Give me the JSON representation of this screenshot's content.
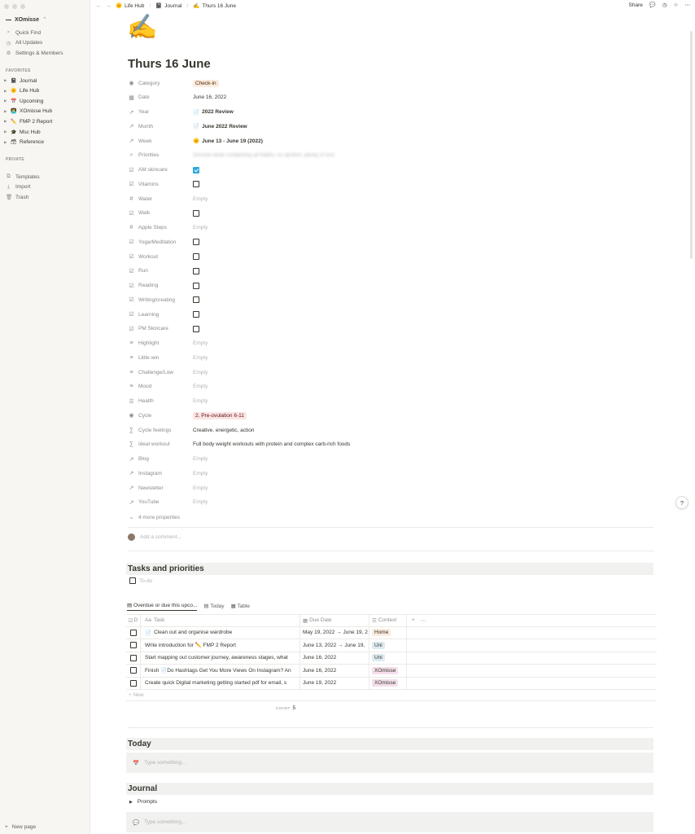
{
  "sidebar": {
    "workspace": "XOmisse",
    "nav": [
      {
        "icon": "⌕",
        "label": "Quick Find",
        "iname": "search-icon"
      },
      {
        "icon": "◷",
        "label": "All Updates",
        "iname": "clock-icon"
      },
      {
        "icon": "⚙",
        "label": "Settings & Members",
        "iname": "gear-icon"
      }
    ],
    "favorites_heading": "FAVORITES",
    "favorites": [
      {
        "emoji": "📓",
        "label": "Journal"
      },
      {
        "emoji": "🌞",
        "label": "Life Hub"
      },
      {
        "emoji": "📅",
        "label": "Upcoming"
      },
      {
        "emoji": "👩‍💻",
        "label": "XOmisse Hub"
      },
      {
        "emoji": "✏️",
        "label": "FMP 2 Report"
      },
      {
        "emoji": "🎓",
        "label": "Msc Hub"
      },
      {
        "emoji": "🗃",
        "label": "Reference"
      }
    ],
    "private_heading": "PRIVATE",
    "private": [
      {
        "icon": "⧉",
        "label": "Templates",
        "iname": "templates-icon"
      },
      {
        "icon": "⤓",
        "label": "Import",
        "iname": "import-icon"
      },
      {
        "icon": "🗑",
        "label": "Trash",
        "iname": "trash-icon"
      }
    ],
    "new_page": "New page"
  },
  "breadcrumb": [
    {
      "emoji": "🌞",
      "label": "Life Hub"
    },
    {
      "emoji": "📓",
      "label": "Journal"
    },
    {
      "emoji": "✍️",
      "label": "Thurs 16 June"
    }
  ],
  "topbar": {
    "share": "Share"
  },
  "page": {
    "icon": "✍️",
    "title": "Thurs 16 June",
    "properties": [
      {
        "icon": "◉",
        "name": "Category",
        "type": "tag",
        "value": "Check-in",
        "bg": "#fbecdd",
        "fg": "#49290e"
      },
      {
        "icon": "▦",
        "name": "Date",
        "type": "text",
        "value": "June 16, 2022"
      },
      {
        "icon": "↗",
        "name": "Year",
        "type": "relation",
        "emoji": "📄",
        "value": "2022 Review"
      },
      {
        "icon": "↗",
        "name": "Month",
        "type": "relation",
        "emoji": "📄",
        "value": "June 2022 Review"
      },
      {
        "icon": "↗",
        "name": "Week",
        "type": "relation",
        "emoji": "🌞",
        "value": "June 13 - June 19 (2022)"
      },
      {
        "icon": "⌕",
        "name": "Priorities",
        "type": "blur",
        "value": "Second week completing all habits, no alcohol, plenty of rest"
      },
      {
        "icon": "☑",
        "name": "AM skincare",
        "type": "check",
        "checked": true
      },
      {
        "icon": "☑",
        "name": "Vitamins",
        "type": "check",
        "checked": false
      },
      {
        "icon": "#",
        "name": "Water",
        "type": "empty",
        "value": "Empty"
      },
      {
        "icon": "☑",
        "name": "Walk",
        "type": "check",
        "checked": false
      },
      {
        "icon": "#",
        "name": "Apple Steps",
        "type": "empty",
        "value": "Empty"
      },
      {
        "icon": "☑",
        "name": "Yoga/Meditation",
        "type": "check",
        "checked": false
      },
      {
        "icon": "☑",
        "name": "Workout",
        "type": "check",
        "checked": false
      },
      {
        "icon": "☑",
        "name": "Run",
        "type": "check",
        "checked": false
      },
      {
        "icon": "☑",
        "name": "Reading",
        "type": "check",
        "checked": false
      },
      {
        "icon": "☑",
        "name": "Writing/creating",
        "type": "check",
        "checked": false
      },
      {
        "icon": "☑",
        "name": "Learning",
        "type": "check",
        "checked": false
      },
      {
        "icon": "☑",
        "name": "PM Skincare",
        "type": "check",
        "checked": false
      },
      {
        "icon": "≡",
        "name": "Highlight",
        "type": "empty",
        "value": "Empty"
      },
      {
        "icon": "≡",
        "name": "Little win",
        "type": "empty",
        "value": "Empty"
      },
      {
        "icon": "≡",
        "name": "Challenge/Low",
        "type": "empty",
        "value": "Empty"
      },
      {
        "icon": "≡",
        "name": "Mood",
        "type": "empty",
        "value": "Empty"
      },
      {
        "icon": "☰",
        "name": "Health",
        "type": "empty",
        "value": "Empty"
      },
      {
        "icon": "◉",
        "name": "Cycle",
        "type": "tag",
        "value": "2. Pre-ovulation 6-11",
        "bg": "#fbe4e4",
        "fg": "#5d1715"
      },
      {
        "icon": "∑",
        "name": "Cycle feelings",
        "type": "text",
        "value": "Creative, energetic, action"
      },
      {
        "icon": "∑",
        "name": "Ideal workout",
        "type": "text",
        "value": "Full body weight workouts with protein and complex carb-rich foods"
      },
      {
        "icon": "↗",
        "name": "Blog",
        "type": "empty",
        "value": "Empty"
      },
      {
        "icon": "↗",
        "name": "Instagram",
        "type": "empty",
        "value": "Empty"
      },
      {
        "icon": "↗",
        "name": "Newsletter",
        "type": "empty",
        "value": "Empty"
      },
      {
        "icon": "↗",
        "name": "YouTube",
        "type": "empty",
        "value": "Empty"
      }
    ],
    "more_properties": "4 more properties",
    "comment_placeholder": "Add a comment..."
  },
  "tasks": {
    "heading": "Tasks and priorities",
    "todo": "To-do",
    "views": [
      {
        "icon": "▤",
        "label": "Overdue or due this upco..."
      },
      {
        "icon": "▤",
        "label": "Today"
      },
      {
        "icon": "▦",
        "label": "Table"
      }
    ],
    "columns": [
      "D",
      "Task",
      "Due Date",
      "Context"
    ],
    "rows": [
      {
        "doc": true,
        "task": "Clean out and organise wardrobe",
        "due": "May 19, 2022 → June 19, 2",
        "context": "Home",
        "cbg": "#fbecdd"
      },
      {
        "doc": false,
        "task": "Write introduction for ✏️ FMP 2 Report",
        "due": "June 13, 2022 → June 19,",
        "context": "Uni",
        "cbg": "#ddebf1"
      },
      {
        "doc": false,
        "task": "Start mapping out customer journey, awareness stages, what",
        "due": "June 16, 2022",
        "context": "Uni",
        "cbg": "#ddebf1"
      },
      {
        "doc": false,
        "task": "Finish 📄Do Hashtags Get You More Views On Instagram? An",
        "due": "June 16, 2022",
        "context": "XOmisse",
        "cbg": "#f4dfeb"
      },
      {
        "doc": false,
        "task": "Create quick Digital marketing getting started pdf for email, s",
        "due": "June 19, 2022",
        "context": "XOmisse",
        "cbg": "#f4dfeb"
      }
    ],
    "new": "+ New",
    "count_label": "COUNT",
    "count": "5"
  },
  "today": {
    "heading": "Today",
    "placeholder": "Type something..."
  },
  "journal": {
    "heading": "Journal",
    "toggle": "Prompts",
    "placeholder": "Type something..."
  }
}
